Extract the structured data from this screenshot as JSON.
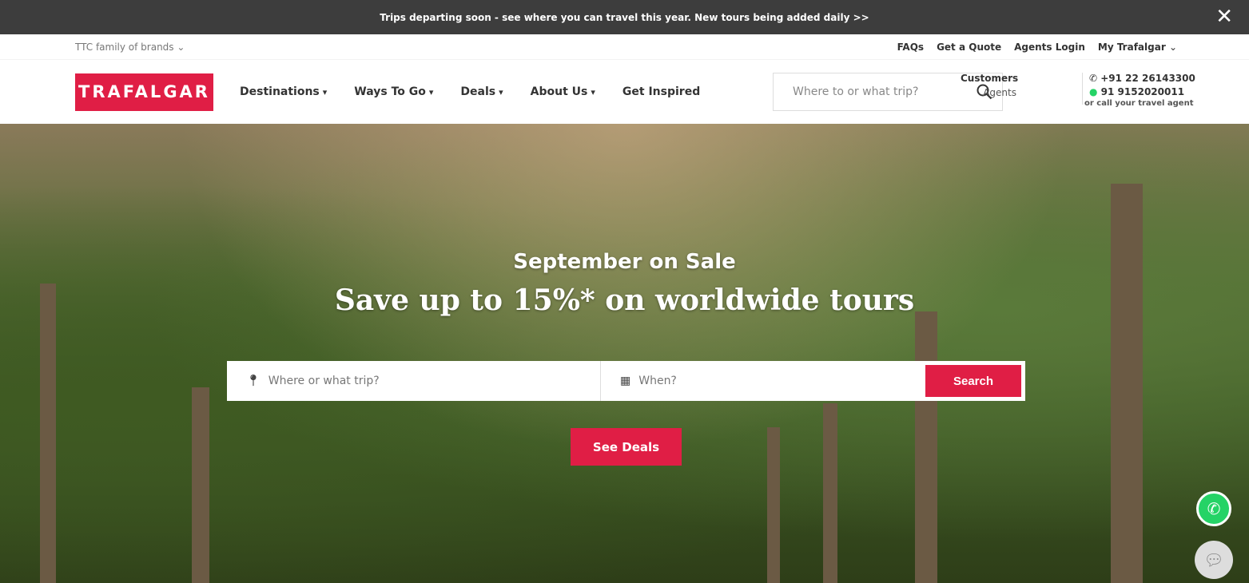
{
  "banner": {
    "text": "Trips departing soon - see where you can travel this year. New tours being added daily >>",
    "close": "✕"
  },
  "util": {
    "brands": "TTC family of brands",
    "links": [
      "FAQs",
      "Get a Quote",
      "Agents Login",
      "My Trafalgar"
    ]
  },
  "logo": "TRAFALGAR",
  "menu": [
    "Destinations",
    "Ways To Go",
    "Deals",
    "About Us",
    "Get Inspired"
  ],
  "search": {
    "placeholder": "Where to or what trip?"
  },
  "contact": {
    "customers": "Customers",
    "agents": "Agents",
    "phone": "+91 22 26143300",
    "whatsapp": "91 9152020011",
    "note": "or call your travel agent"
  },
  "hero": {
    "subtitle": "September on Sale",
    "title": "Save up to 15%* on worldwide tours",
    "where_placeholder": "Where or what trip?",
    "when_placeholder": "When?",
    "search_button": "Search",
    "deals_button": "See Deals"
  },
  "colors": {
    "brand": "#e01e45"
  }
}
